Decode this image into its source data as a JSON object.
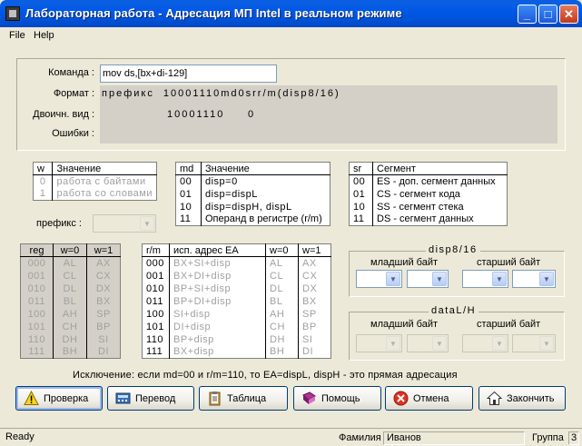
{
  "window": {
    "title": "Лабораторная работа - Адресация МП Intel в реальном режиме",
    "minimize": "_",
    "maximize": "□",
    "close": "✕"
  },
  "menu": {
    "file": "File",
    "help": "Help"
  },
  "command": {
    "label": "Команда :",
    "value": "mov ds,[bx+di-129]"
  },
  "format": {
    "label": "Формат :",
    "value": "префикс  10001110md0srr/m(disp8/16)"
  },
  "binary": {
    "label": "Двоичн. вид :",
    "value1": "10001110",
    "value2": "0"
  },
  "errors": {
    "label": "Ошибки :",
    "value": ""
  },
  "w_table": {
    "headers": [
      "w",
      "Значение"
    ],
    "rows": [
      [
        "0",
        "работа с байтами"
      ],
      [
        "1",
        "работа со словами"
      ]
    ]
  },
  "prefix": {
    "label": "префикс :",
    "value": ""
  },
  "md_table": {
    "headers": [
      "md",
      "Значение"
    ],
    "rows": [
      [
        "00",
        "disp=0"
      ],
      [
        "01",
        "disp=dispL"
      ],
      [
        "10",
        "disp=dispH, dispL"
      ],
      [
        "11",
        "Операнд в регистре (r/m)"
      ]
    ]
  },
  "sr_table": {
    "headers": [
      "sr",
      "Сегмент"
    ],
    "rows": [
      [
        "00",
        "ES - доп. сегмент данных"
      ],
      [
        "01",
        "CS - сегмент кода"
      ],
      [
        "10",
        "SS - сегмент стека"
      ],
      [
        "11",
        "DS - сегмент данных"
      ]
    ]
  },
  "reg_table": {
    "headers": [
      "reg",
      "w=0",
      "w=1"
    ],
    "rows": [
      [
        "000",
        "AL",
        "AX"
      ],
      [
        "001",
        "CL",
        "CX"
      ],
      [
        "010",
        "DL",
        "DX"
      ],
      [
        "011",
        "BL",
        "BX"
      ],
      [
        "100",
        "AH",
        "SP"
      ],
      [
        "101",
        "CH",
        "BP"
      ],
      [
        "110",
        "DH",
        "SI"
      ],
      [
        "111",
        "BH",
        "DI"
      ]
    ]
  },
  "rm_table": {
    "headers": [
      "r/m",
      "исп. адрес EA",
      "w=0",
      "w=1"
    ],
    "rows": [
      [
        "000",
        "BX+SI+disp",
        "AL",
        "AX"
      ],
      [
        "001",
        "BX+DI+disp",
        "CL",
        "CX"
      ],
      [
        "010",
        "BP+SI+disp",
        "DL",
        "DX"
      ],
      [
        "011",
        "BP+DI+disp",
        "BL",
        "BX"
      ],
      [
        "100",
        "SI+disp",
        "AH",
        "SP"
      ],
      [
        "101",
        "DI+disp",
        "CH",
        "BP"
      ],
      [
        "110",
        "BP+disp",
        "DH",
        "SI"
      ],
      [
        "111",
        "BX+disp",
        "BH",
        "DI"
      ]
    ]
  },
  "disp_group": {
    "title": "disp8/16",
    "low": "младший байт",
    "high": "старший байт"
  },
  "data_group": {
    "title": "dataL/H",
    "low": "младший байт",
    "high": "старший байт"
  },
  "exception": "Исключение: если md=00 и r/m=110, то EA=dispL, dispH - это прямая адресация",
  "buttons": {
    "check": "Проверка",
    "translate": "Перевод",
    "table": "Таблица",
    "help": "Помощь",
    "cancel": "Отмена",
    "finish": "Закончить"
  },
  "status": {
    "ready": "Ready",
    "surname_label": "Фамилия",
    "surname": "Иванов",
    "group_label": "Группа",
    "group": "3"
  },
  "colors": {
    "title_bar": "#0054e3",
    "disabled_text": "#a0a0a0",
    "panel_grey": "#d4d0c8"
  }
}
